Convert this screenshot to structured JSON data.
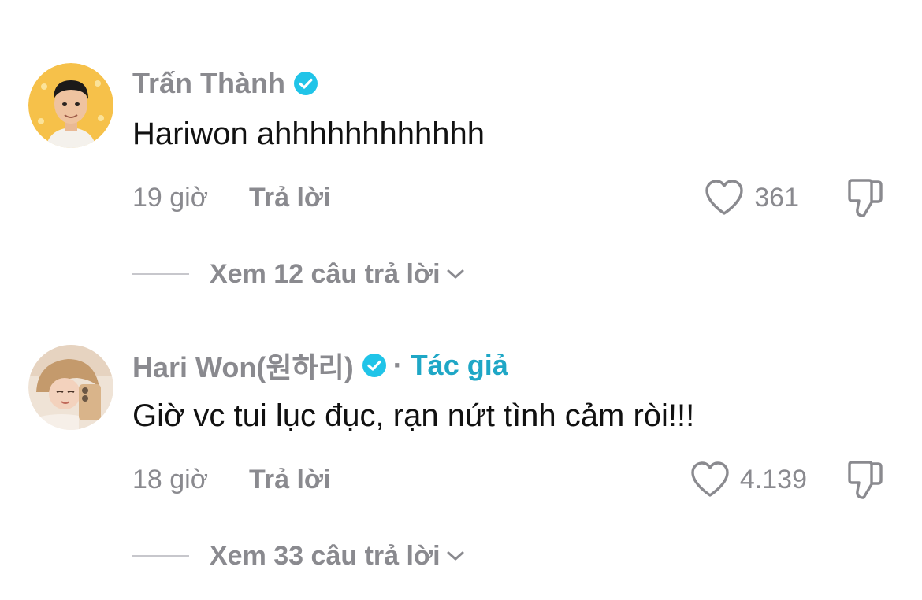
{
  "comments": [
    {
      "username": "Trấn Thành",
      "verified": true,
      "author_label": "",
      "text": "Hariwon ahhhhhhhhhhhh",
      "time": "19 giờ",
      "reply_label": "Trả lời",
      "likes": "361",
      "view_replies": "Xem 12 câu trả lời",
      "avatar": "avatar-man-yellow-bg"
    },
    {
      "username": "Hari Won(원하리)",
      "verified": true,
      "separator": "·",
      "author_label": "Tác giả",
      "text": "Giờ vc tui lục đục, rạn nứt tình cảm ròi!!!",
      "time": "18 giờ",
      "reply_label": "Trả lời",
      "likes": "4.139",
      "view_replies": "Xem 33 câu trả lời",
      "avatar": "avatar-woman-selfie"
    }
  ],
  "colors": {
    "verified": "#20c4e8",
    "author_label": "#1fa7c6",
    "muted": "#8a8a8f",
    "text": "#111111"
  },
  "icons": [
    "verified-badge-icon",
    "heart-icon",
    "dislike-icon",
    "chevron-down-icon"
  ]
}
